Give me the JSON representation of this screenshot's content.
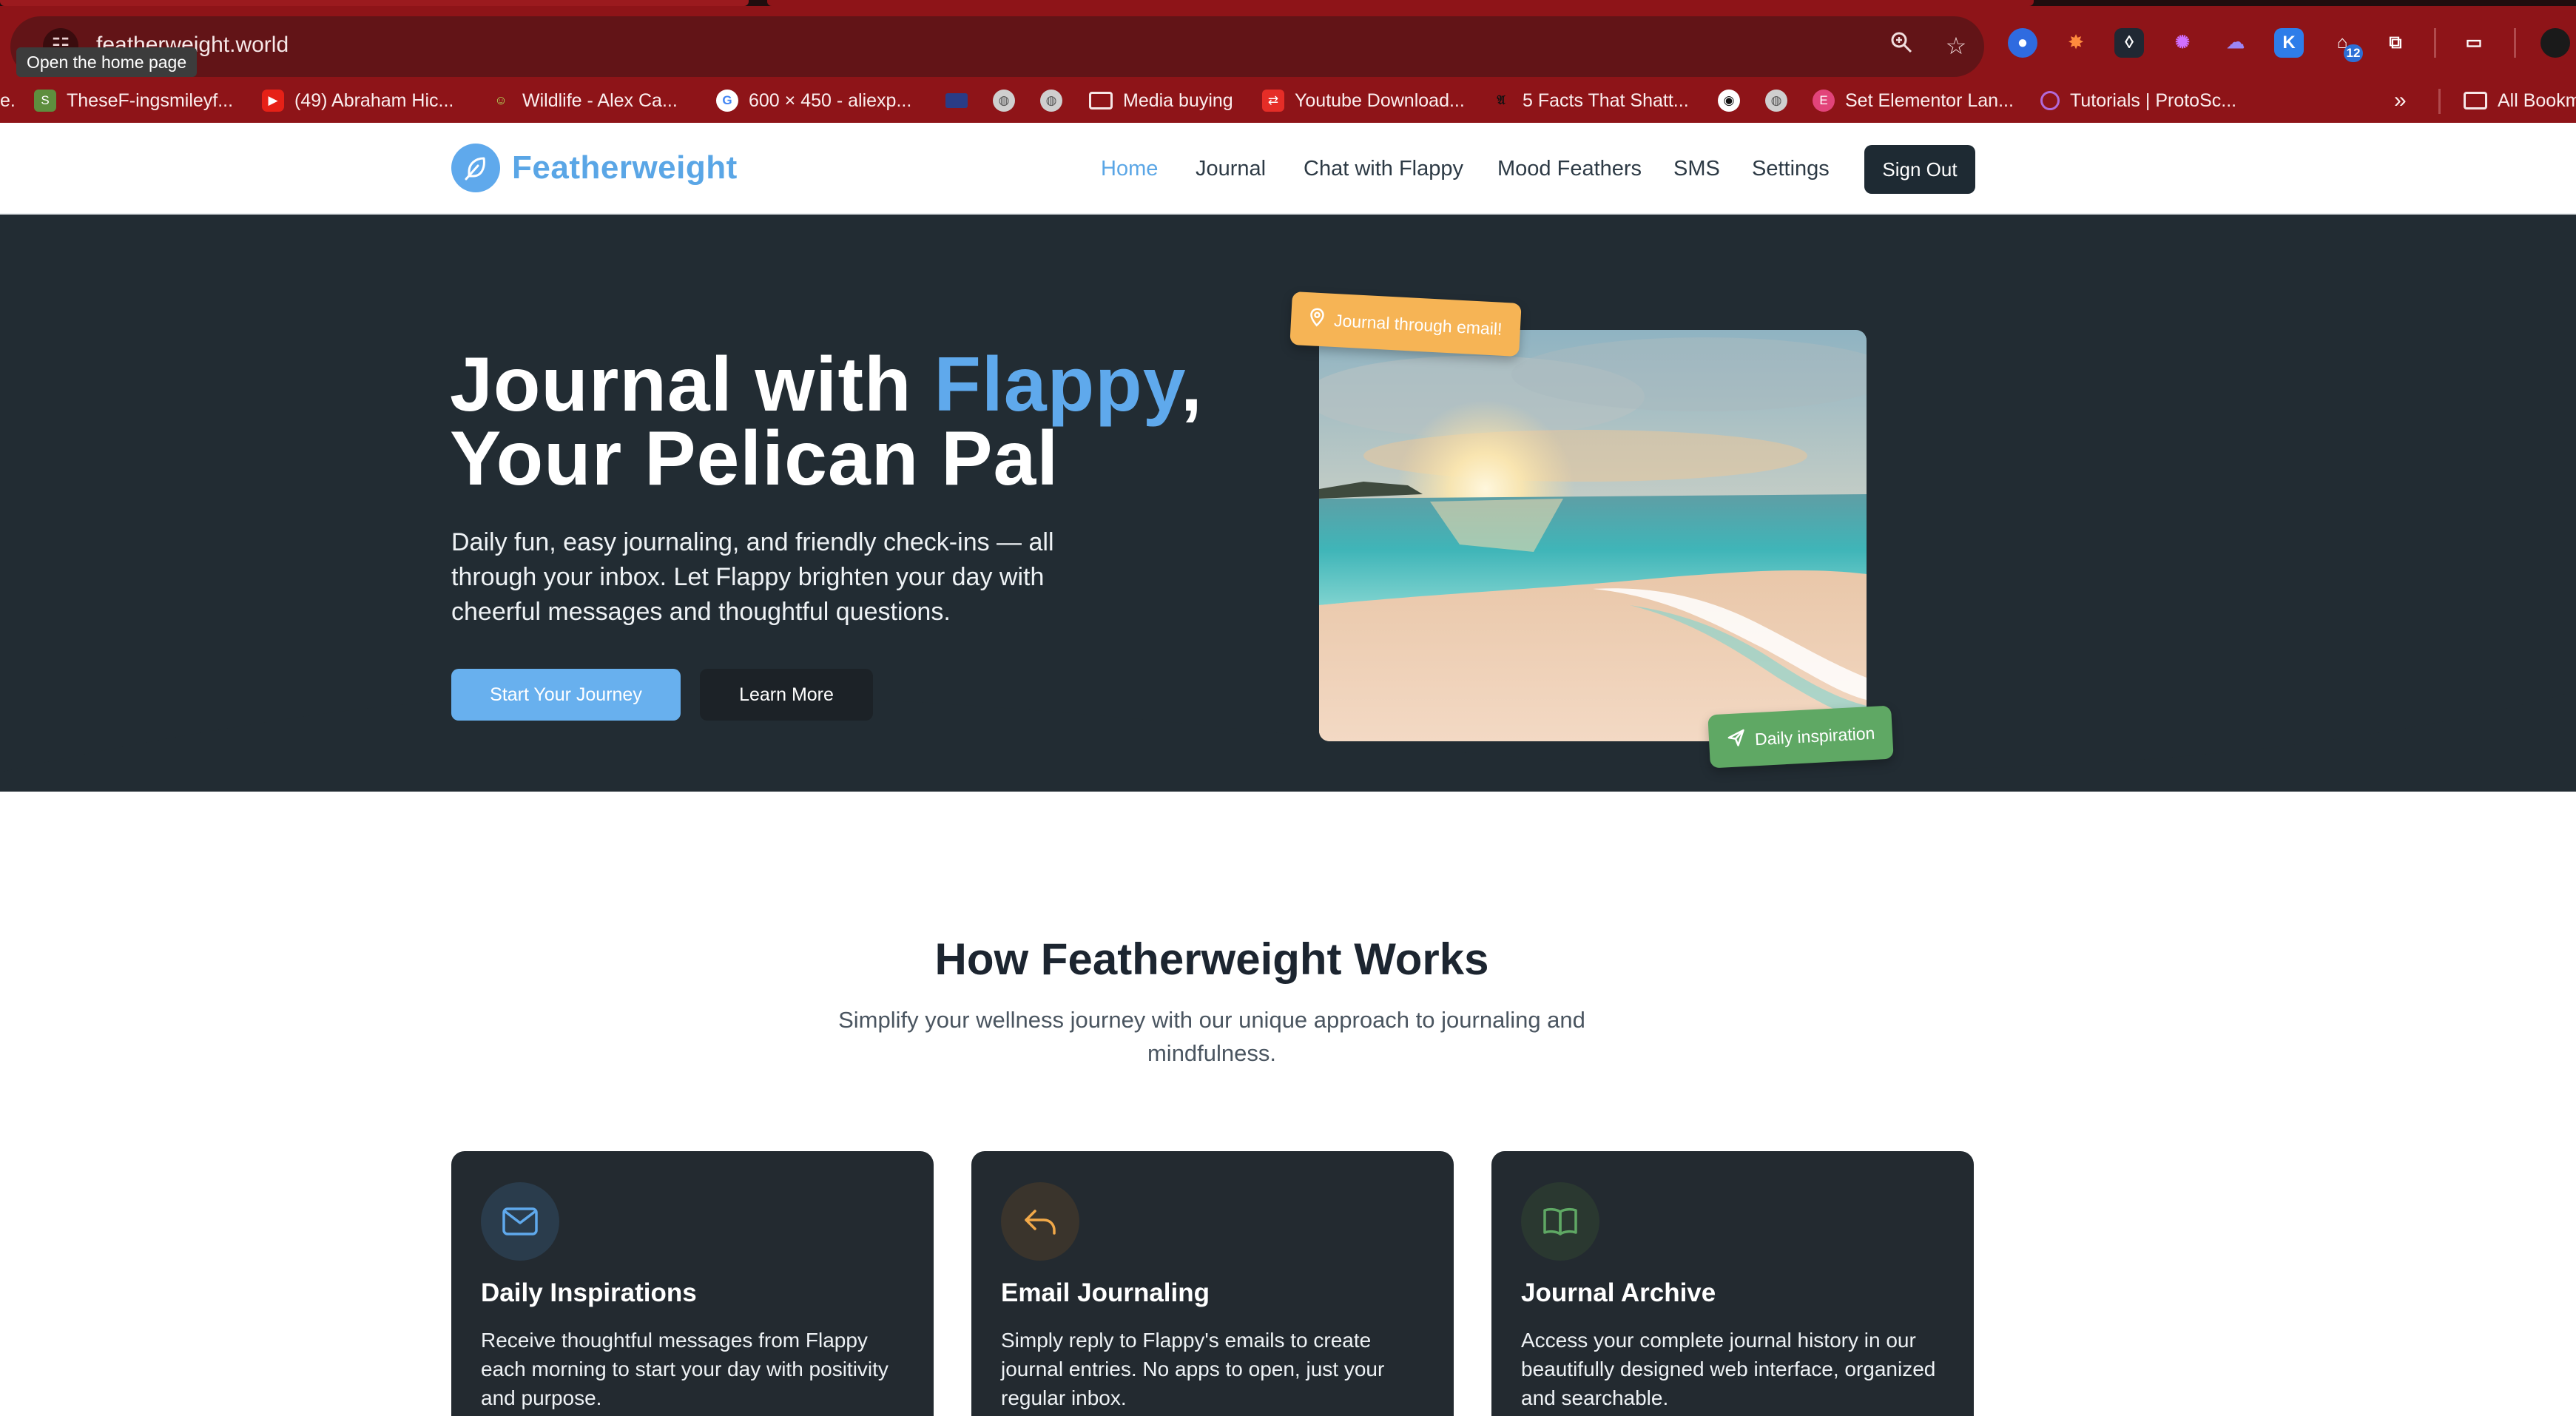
{
  "browser": {
    "url": "featherweight.world",
    "tooltip": "Open the home page",
    "extension_badge": "12",
    "bookmarks": [
      {
        "label": "e.",
        "icon": "none"
      },
      {
        "label": "TheseF-ingsmileyf...",
        "icon": "shopify-icon"
      },
      {
        "label": "(49) Abraham Hic...",
        "icon": "youtube-icon"
      },
      {
        "label": "Wildlife - Alex Ca...",
        "icon": "wildlife-icon"
      },
      {
        "label": "600 × 450 - aliexp...",
        "icon": "google-icon"
      },
      {
        "label": "",
        "icon": "flag-icon"
      },
      {
        "label": "",
        "icon": "globe-icon"
      },
      {
        "label": "",
        "icon": "globe-icon"
      },
      {
        "label": "Media buying",
        "icon": "folder-icon"
      },
      {
        "label": "Youtube Download...",
        "icon": "download-icon"
      },
      {
        "label": "5 Facts That Shatt...",
        "icon": "gothic-icon"
      },
      {
        "label": "",
        "icon": "circle-icon"
      },
      {
        "label": "",
        "icon": "globe-icon"
      },
      {
        "label": "Set Elementor Lan...",
        "icon": "elementor-icon"
      },
      {
        "label": "Tutorials | ProtoSc...",
        "icon": "protoscript-icon"
      },
      {
        "label": "All Bookm",
        "icon": "folder-icon"
      }
    ]
  },
  "nav": {
    "brand": "Featherweight",
    "links": [
      "Home",
      "Journal",
      "Chat with Flappy",
      "Mood Feathers",
      "SMS",
      "Settings"
    ],
    "active": "Home",
    "signout": "Sign Out"
  },
  "hero": {
    "title_part1": "Journal with ",
    "title_accent": "Flappy",
    "title_part2": ",",
    "title_line2": "Your Pelican Pal",
    "subtitle": "Daily fun, easy journaling, and friendly check-ins — all through your inbox. Let Flappy brighten your day with cheerful messages and thoughtful questions.",
    "cta_primary": "Start Your Journey",
    "cta_secondary": "Learn More",
    "pill_email": "Journal through email!",
    "pill_daily": "Daily inspiration"
  },
  "how": {
    "title": "How Featherweight Works",
    "subtitle": "Simplify your wellness journey with our unique approach to journaling and mindfulness.",
    "cards": [
      {
        "title": "Daily Inspirations",
        "text": "Receive thoughtful messages from Flappy each morning to start your day with positivity and purpose.",
        "icon": "mail-icon"
      },
      {
        "title": "Email Journaling",
        "text": "Simply reply to Flappy's emails to create journal entries. No apps to open, just your regular inbox.",
        "icon": "reply-icon"
      },
      {
        "title": "Journal Archive",
        "text": "Access your complete journal history in our beautifully designed web interface, organized and searchable.",
        "icon": "book-icon"
      }
    ]
  },
  "colors": {
    "accent_blue": "#5fa9ec",
    "hero_bg": "#222c33",
    "chrome_red": "#8e1418",
    "pill_orange": "#f6b455",
    "pill_green": "#5fa864"
  }
}
